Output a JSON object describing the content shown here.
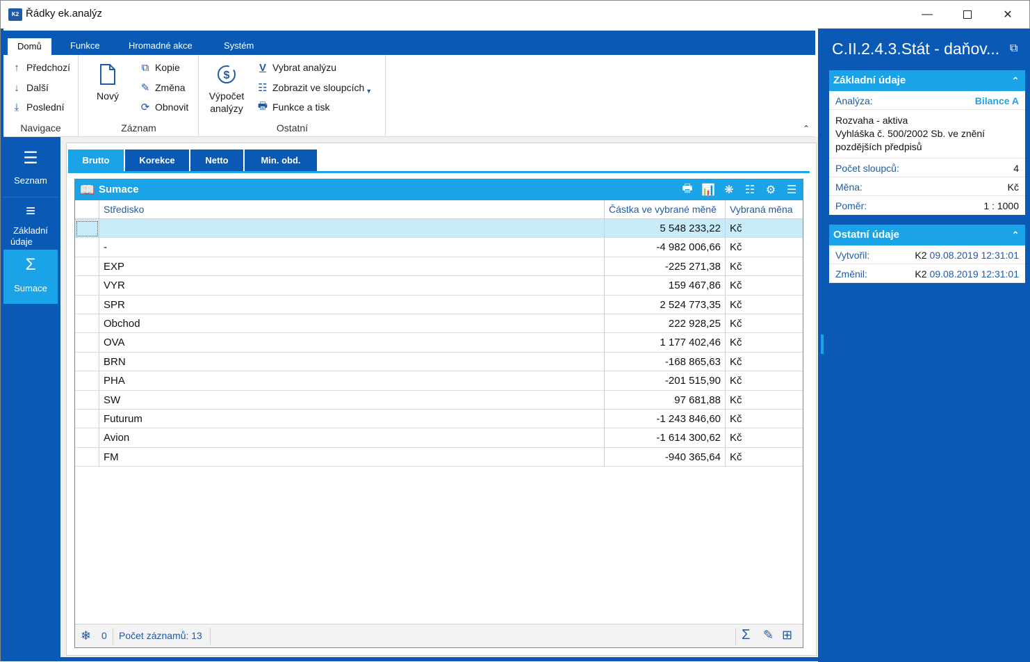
{
  "window": {
    "title": "Řádky ek.analýz",
    "minimize": "—",
    "maximize": "☐",
    "close": "✕"
  },
  "ribbon": {
    "tabs": [
      "Domů",
      "Funkce",
      "Hromadné akce",
      "Systém"
    ],
    "active_tab": "Domů",
    "navigace": {
      "label": "Navigace",
      "predchozi": "Předchozí",
      "dalsi": "Další",
      "posledni": "Poslední"
    },
    "zaznam": {
      "label": "Záznam",
      "novy": "Nový",
      "kopie": "Kopie",
      "zmena": "Změna",
      "obnovit": "Obnovit"
    },
    "ostatni": {
      "label": "Ostatní",
      "vypocet_line1": "Výpočet",
      "vypocet_line2": "analýzy",
      "vybrat": "Vybrat analýzu",
      "zobrazit": "Zobrazit ve sloupcích",
      "funkce_tisk": "Funkce a tisk"
    }
  },
  "sidenav": {
    "items": [
      {
        "label": "Seznam",
        "icon": "hamburger-icon"
      },
      {
        "label_line1": "Základní",
        "label_line2": "údaje",
        "icon": "list-icon"
      },
      {
        "label": "Sumace",
        "icon": "sigma-icon"
      }
    ],
    "active": "Sumace"
  },
  "subtabs": [
    "Brutto",
    "Korekce",
    "Netto",
    "Min. obd."
  ],
  "active_subtab": "Brutto",
  "panel": {
    "title": "Sumace",
    "columns": [
      "Středisko",
      "Částka ve vybrané měně",
      "Vybraná měna"
    ],
    "rows": [
      {
        "stredisko": "",
        "castka": "5 548 233,22",
        "mena": "Kč"
      },
      {
        "stredisko": "-",
        "castka": "-4 982 006,66",
        "mena": "Kč"
      },
      {
        "stredisko": "EXP",
        "castka": "-225 271,38",
        "mena": "Kč"
      },
      {
        "stredisko": "VYR",
        "castka": "159 467,86",
        "mena": "Kč"
      },
      {
        "stredisko": "SPR",
        "castka": "2 524 773,35",
        "mena": "Kč"
      },
      {
        "stredisko": "Obchod",
        "castka": "222 928,25",
        "mena": "Kč"
      },
      {
        "stredisko": "OVA",
        "castka": "1 177 402,46",
        "mena": "Kč"
      },
      {
        "stredisko": "BRN",
        "castka": "-168 865,63",
        "mena": "Kč"
      },
      {
        "stredisko": "PHA",
        "castka": "-201 515,90",
        "mena": "Kč"
      },
      {
        "stredisko": "SW",
        "castka": "97 681,88",
        "mena": "Kč"
      },
      {
        "stredisko": "Futurum",
        "castka": "-1 243 846,60",
        "mena": "Kč"
      },
      {
        "stredisko": "Avion",
        "castka": "-1 614 300,62",
        "mena": "Kč"
      },
      {
        "stredisko": "FM",
        "castka": "-940 365,64",
        "mena": "Kč"
      }
    ],
    "selected_row": 0,
    "footer": {
      "marked_count": "0",
      "record_count": "Počet záznamů: 13"
    }
  },
  "right": {
    "title": "C.II.2.4.3.Stát - daňov...",
    "zakladni": {
      "header": "Základní údaje",
      "analyza_label": "Analýza:",
      "analyza_value": "Bilance A",
      "note_line1": "Rozvaha - aktiva",
      "note_line2": "Vyhláška č. 500/2002 Sb. ve znění",
      "note_line3": "pozdějších předpisů",
      "pocet_label": "Počet sloupců:",
      "pocet_value": "4",
      "mena_label": "Měna:",
      "mena_value": "Kč",
      "pomer_label": "Poměr:",
      "pomer_value": "1 : 1000"
    },
    "ostatni": {
      "header": "Ostatní údaje",
      "vytvoril_label": "Vytvořil:",
      "vytvoril_user": "K2",
      "vytvoril_date": "09.08.2019 12:31:01",
      "zmenil_label": "Změnil:",
      "zmenil_user": "K2",
      "zmenil_date": "09.08.2019 12:31:01"
    }
  },
  "colors": {
    "frame_blue": "#0a5ab5",
    "accent_blue": "#1aa3e6",
    "selected_row": "#c8ebf9"
  }
}
